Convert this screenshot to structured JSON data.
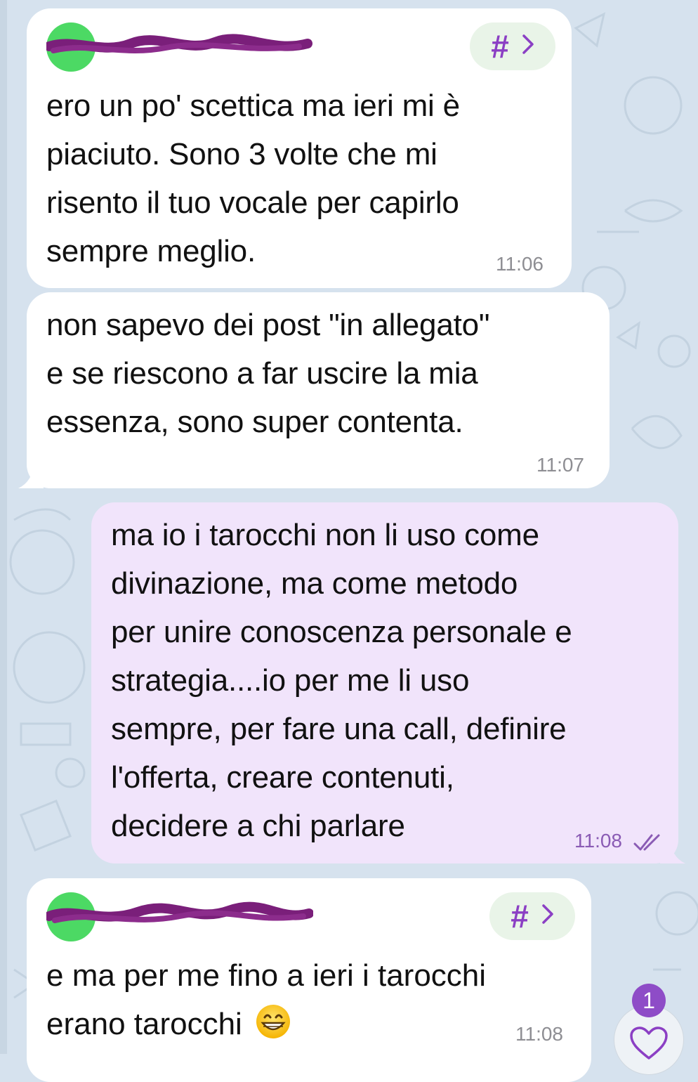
{
  "messages": [
    {
      "direction": "incoming",
      "sender_redacted": true,
      "hashtag_button": {
        "symbol": "#",
        "chevron": ">"
      },
      "text": "ero un po' scettica ma ieri mi è\npiaciuto. Sono 3 volte che mi\nrisento il tuo vocale per capirlo\nsempre meglio.",
      "time": "11:06"
    },
    {
      "direction": "incoming",
      "text": "non sapevo dei post \"in allegato\"\ne se riescono a far uscire la mia\nessenza, sono super contenta.",
      "time": "11:07"
    },
    {
      "direction": "outgoing",
      "text": "ma io i tarocchi non li uso come\ndivinazione, ma come metodo\nper unire conoscenza personale e\nstrategia....io per me li uso\nsempre, per fare una call, definire\nl'offerta, creare contenuti,\ndecidere a chi parlare",
      "time": "11:08",
      "read_status_icon": "double-check-icon"
    },
    {
      "direction": "incoming",
      "sender_redacted": true,
      "hashtag_button": {
        "symbol": "#",
        "chevron": ">"
      },
      "text": "e ma per me fino a ieri i tarocchi\nerano tarocchi",
      "emoji": "grinning-face-emoji",
      "time": "11:08"
    }
  ],
  "reaction": {
    "icon": "heart-icon",
    "badge_count": "1"
  },
  "colors": {
    "background": "#d6e2ee",
    "incoming_bubble": "#ffffff",
    "outgoing_bubble": "#f1e4fb",
    "accent": "#8b3fc4",
    "avatar": "#4cd964",
    "redaction": "#7a1f7a"
  }
}
